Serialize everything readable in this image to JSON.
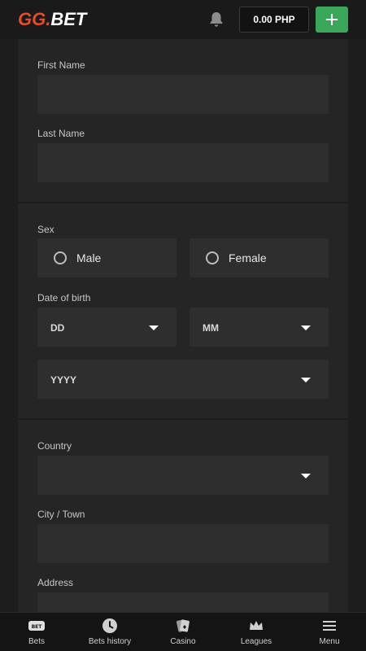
{
  "header": {
    "logo_gg": "GG",
    "logo_dot": ".",
    "logo_bet": "BET",
    "balance": "0.00 PHP",
    "accent_color": "#e34d2a",
    "deposit_color": "#3aa65a"
  },
  "form": {
    "first_name_label": "First Name",
    "first_name_value": "",
    "last_name_label": "Last Name",
    "last_name_value": "",
    "sex_label": "Sex",
    "sex_options": [
      "Male",
      "Female"
    ],
    "dob_label": "Date of birth",
    "dob_day": "DD",
    "dob_month": "MM",
    "dob_year": "YYYY",
    "country_label": "Country",
    "country_value": "",
    "city_label": "City / Town",
    "city_value": "",
    "address_label": "Address",
    "address_value": ""
  },
  "bottom_nav": {
    "items": [
      {
        "label": "Bets",
        "icon": "bet-ticket-icon"
      },
      {
        "label": "Bets history",
        "icon": "clock-icon"
      },
      {
        "label": "Casino",
        "icon": "cards-icon"
      },
      {
        "label": "Leagues",
        "icon": "crown-icon"
      },
      {
        "label": "Menu",
        "icon": "hamburger-icon"
      }
    ]
  }
}
